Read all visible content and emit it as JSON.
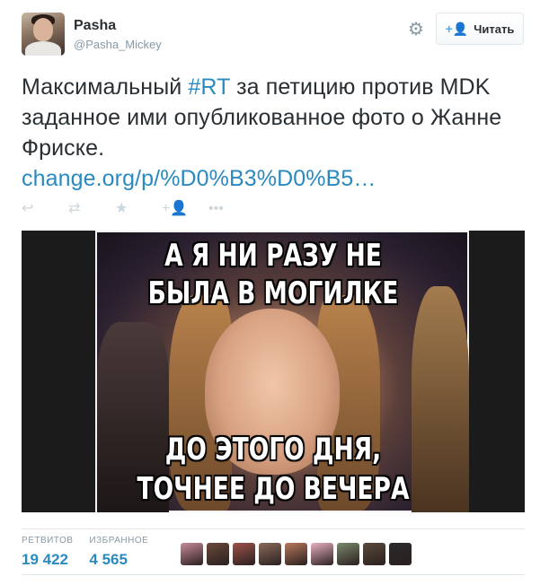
{
  "user": {
    "name": "Pasha",
    "handle": "@Pasha_Mickey"
  },
  "header": {
    "settings_icon": "gear-icon",
    "follow_icon": "add-user-icon",
    "follow_label": "Читать"
  },
  "tweet": {
    "text_before": "Максимальный ",
    "hashtag": "#RT",
    "text_after": " за петицию против MDK заданное ими опубликованное фото о Жанне Фриске.",
    "link": "change.org/p/%D0%B3%D0%B5…"
  },
  "actions": {
    "reply_icon": "reply-icon",
    "retweet_icon": "retweet-icon",
    "favorite_icon": "star-icon",
    "follow_icon": "add-user-icon",
    "more_icon": "more-icon"
  },
  "media": {
    "caption_top_line1": "А Я НИ РАЗУ НЕ",
    "caption_top_line2": "БЫЛА В МОГИЛКЕ",
    "caption_bottom_line1": "ДО ЭТОГО ДНЯ,",
    "caption_bottom_line2": "ТОЧНЕЕ ДО ВЕЧЕРА"
  },
  "stats": {
    "retweets_label": "РЕТВИТОВ",
    "retweets_value": "19 422",
    "favorites_label": "ИЗБРАННОЕ",
    "favorites_value": "4 565"
  },
  "favoriter_colors": [
    "#c98a9a",
    "#6b4a3a",
    "#a0524a",
    "#8a6a5a",
    "#b8785a",
    "#e8b0c0",
    "#7a8a6a",
    "#5a4a3a",
    "#2a2a2a"
  ]
}
